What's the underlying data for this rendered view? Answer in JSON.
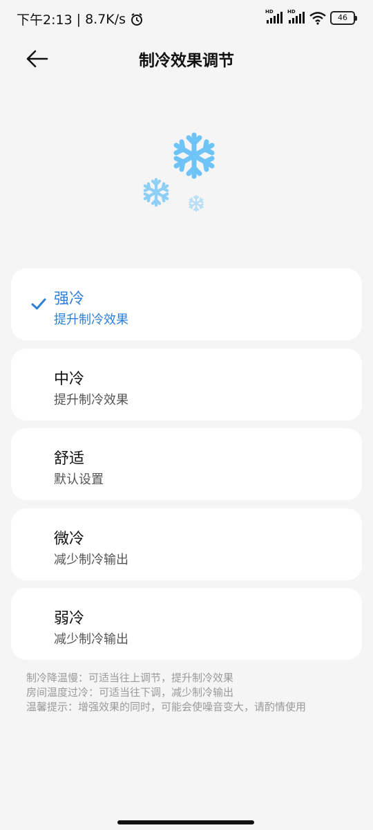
{
  "status_bar": {
    "time": "下午2:13",
    "separator": "|",
    "net_speed": "8.7K/s",
    "hd_label_1": "HD",
    "hd_label_2": "HD",
    "battery": "46"
  },
  "header": {
    "title": "制冷效果调节"
  },
  "options": [
    {
      "title": "强冷",
      "subtitle": "提升制冷效果",
      "selected": true
    },
    {
      "title": "中冷",
      "subtitle": "提升制冷效果",
      "selected": false
    },
    {
      "title": "舒适",
      "subtitle": "默认设置",
      "selected": false
    },
    {
      "title": "微冷",
      "subtitle": "减少制冷输出",
      "selected": false
    },
    {
      "title": "弱冷",
      "subtitle": "减少制冷输出",
      "selected": false
    }
  ],
  "notes": [
    "制冷降温慢：可适当往上调节，提升制冷效果",
    "房间温度过冷：可适当往下调，减少制冷输出",
    "温馨提示：增强效果的同时，可能会使噪音变大，请酌情使用"
  ],
  "colors": {
    "accent": "#2e7fd9",
    "snowflake": "#6ec3f7",
    "background": "#f5f5f5"
  },
  "icons": {
    "back": "arrow-left-icon",
    "check": "check-icon",
    "illustration": "snowflake-icon"
  }
}
